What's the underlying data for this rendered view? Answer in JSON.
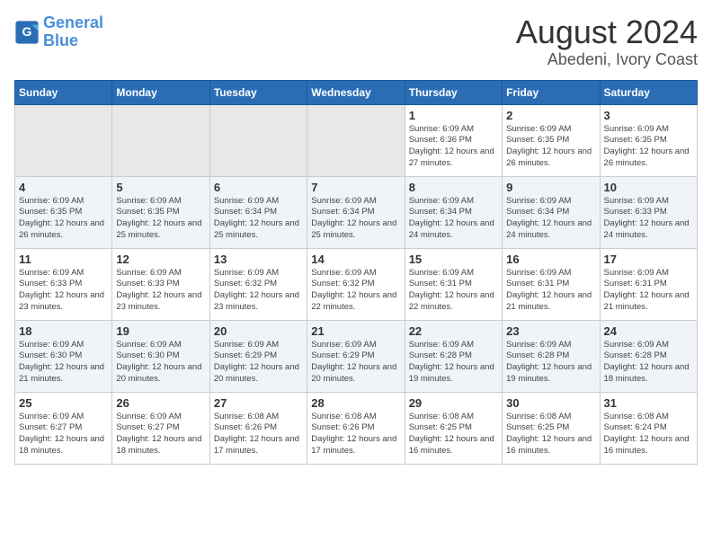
{
  "logo": {
    "line1": "General",
    "line2": "Blue"
  },
  "title": "August 2024",
  "subtitle": "Abedeni, Ivory Coast",
  "days_of_week": [
    "Sunday",
    "Monday",
    "Tuesday",
    "Wednesday",
    "Thursday",
    "Friday",
    "Saturday"
  ],
  "weeks": [
    [
      {
        "day": "",
        "info": ""
      },
      {
        "day": "",
        "info": ""
      },
      {
        "day": "",
        "info": ""
      },
      {
        "day": "",
        "info": ""
      },
      {
        "day": "1",
        "sunrise": "6:09 AM",
        "sunset": "6:36 PM",
        "daylight": "12 hours and 27 minutes."
      },
      {
        "day": "2",
        "sunrise": "6:09 AM",
        "sunset": "6:35 PM",
        "daylight": "12 hours and 26 minutes."
      },
      {
        "day": "3",
        "sunrise": "6:09 AM",
        "sunset": "6:35 PM",
        "daylight": "12 hours and 26 minutes."
      }
    ],
    [
      {
        "day": "4",
        "sunrise": "6:09 AM",
        "sunset": "6:35 PM",
        "daylight": "12 hours and 26 minutes."
      },
      {
        "day": "5",
        "sunrise": "6:09 AM",
        "sunset": "6:35 PM",
        "daylight": "12 hours and 25 minutes."
      },
      {
        "day": "6",
        "sunrise": "6:09 AM",
        "sunset": "6:34 PM",
        "daylight": "12 hours and 25 minutes."
      },
      {
        "day": "7",
        "sunrise": "6:09 AM",
        "sunset": "6:34 PM",
        "daylight": "12 hours and 25 minutes."
      },
      {
        "day": "8",
        "sunrise": "6:09 AM",
        "sunset": "6:34 PM",
        "daylight": "12 hours and 24 minutes."
      },
      {
        "day": "9",
        "sunrise": "6:09 AM",
        "sunset": "6:34 PM",
        "daylight": "12 hours and 24 minutes."
      },
      {
        "day": "10",
        "sunrise": "6:09 AM",
        "sunset": "6:33 PM",
        "daylight": "12 hours and 24 minutes."
      }
    ],
    [
      {
        "day": "11",
        "sunrise": "6:09 AM",
        "sunset": "6:33 PM",
        "daylight": "12 hours and 23 minutes."
      },
      {
        "day": "12",
        "sunrise": "6:09 AM",
        "sunset": "6:33 PM",
        "daylight": "12 hours and 23 minutes."
      },
      {
        "day": "13",
        "sunrise": "6:09 AM",
        "sunset": "6:32 PM",
        "daylight": "12 hours and 23 minutes."
      },
      {
        "day": "14",
        "sunrise": "6:09 AM",
        "sunset": "6:32 PM",
        "daylight": "12 hours and 22 minutes."
      },
      {
        "day": "15",
        "sunrise": "6:09 AM",
        "sunset": "6:31 PM",
        "daylight": "12 hours and 22 minutes."
      },
      {
        "day": "16",
        "sunrise": "6:09 AM",
        "sunset": "6:31 PM",
        "daylight": "12 hours and 21 minutes."
      },
      {
        "day": "17",
        "sunrise": "6:09 AM",
        "sunset": "6:31 PM",
        "daylight": "12 hours and 21 minutes."
      }
    ],
    [
      {
        "day": "18",
        "sunrise": "6:09 AM",
        "sunset": "6:30 PM",
        "daylight": "12 hours and 21 minutes."
      },
      {
        "day": "19",
        "sunrise": "6:09 AM",
        "sunset": "6:30 PM",
        "daylight": "12 hours and 20 minutes."
      },
      {
        "day": "20",
        "sunrise": "6:09 AM",
        "sunset": "6:29 PM",
        "daylight": "12 hours and 20 minutes."
      },
      {
        "day": "21",
        "sunrise": "6:09 AM",
        "sunset": "6:29 PM",
        "daylight": "12 hours and 20 minutes."
      },
      {
        "day": "22",
        "sunrise": "6:09 AM",
        "sunset": "6:28 PM",
        "daylight": "12 hours and 19 minutes."
      },
      {
        "day": "23",
        "sunrise": "6:09 AM",
        "sunset": "6:28 PM",
        "daylight": "12 hours and 19 minutes."
      },
      {
        "day": "24",
        "sunrise": "6:09 AM",
        "sunset": "6:28 PM",
        "daylight": "12 hours and 18 minutes."
      }
    ],
    [
      {
        "day": "25",
        "sunrise": "6:09 AM",
        "sunset": "6:27 PM",
        "daylight": "12 hours and 18 minutes."
      },
      {
        "day": "26",
        "sunrise": "6:09 AM",
        "sunset": "6:27 PM",
        "daylight": "12 hours and 18 minutes."
      },
      {
        "day": "27",
        "sunrise": "6:08 AM",
        "sunset": "6:26 PM",
        "daylight": "12 hours and 17 minutes."
      },
      {
        "day": "28",
        "sunrise": "6:08 AM",
        "sunset": "6:26 PM",
        "daylight": "12 hours and 17 minutes."
      },
      {
        "day": "29",
        "sunrise": "6:08 AM",
        "sunset": "6:25 PM",
        "daylight": "12 hours and 16 minutes."
      },
      {
        "day": "30",
        "sunrise": "6:08 AM",
        "sunset": "6:25 PM",
        "daylight": "12 hours and 16 minutes."
      },
      {
        "day": "31",
        "sunrise": "6:08 AM",
        "sunset": "6:24 PM",
        "daylight": "12 hours and 16 minutes."
      }
    ]
  ]
}
